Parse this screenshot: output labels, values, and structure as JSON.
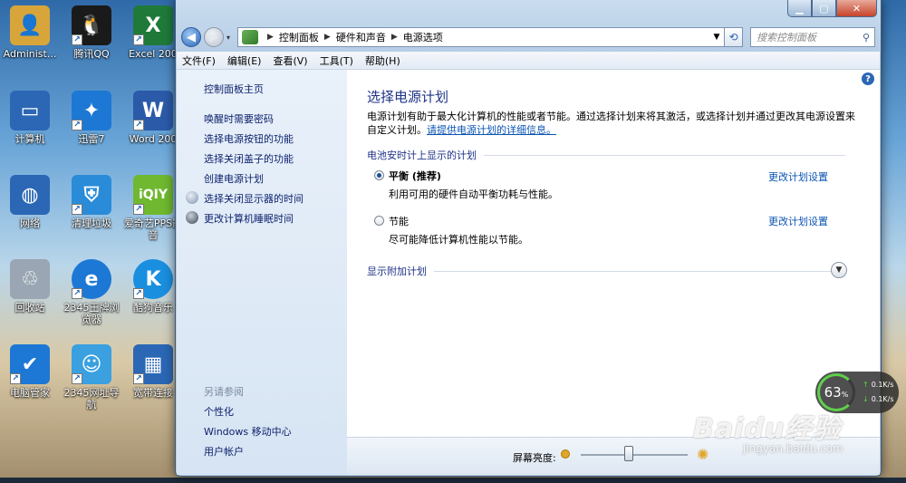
{
  "desktop": {
    "icons": [
      {
        "label": "Administ...",
        "glyph": "user-folder-icon",
        "color": "#d8a53a"
      },
      {
        "label": "腾讯QQ",
        "glyph": "qq-penguin-icon",
        "color": "#1a1a1a"
      },
      {
        "label": "Excel 200",
        "glyph": "excel-icon",
        "color": "#1f7a3a"
      },
      {
        "label": "计算机",
        "glyph": "computer-icon",
        "color": "#2b67b5"
      },
      {
        "label": "迅雷7",
        "glyph": "thunder-icon",
        "color": "#1c78d4"
      },
      {
        "label": "Word 200",
        "glyph": "word-icon",
        "color": "#2b5aa8"
      },
      {
        "label": "网络",
        "glyph": "network-icon",
        "color": "#2b67b5"
      },
      {
        "label": "清理垃圾",
        "glyph": "shield-clean-icon",
        "color": "#2a8bd8"
      },
      {
        "label": "爱奇艺PPS影音",
        "glyph": "iqiyi-icon",
        "color": "#6fb82f"
      },
      {
        "label": "回收站",
        "glyph": "recycle-bin-icon",
        "color": "#9aa6b4"
      },
      {
        "label": "2345王牌浏览器",
        "glyph": "browser-e-icon",
        "color": "#1c78d4"
      },
      {
        "label": "酷狗音乐",
        "glyph": "kugou-icon",
        "color": "#1a8fe0"
      },
      {
        "label": "电脑管家",
        "glyph": "pc-manager-icon",
        "color": "#1c78d4"
      },
      {
        "label": "2345网址导航",
        "glyph": "nav-mascot-icon",
        "color": "#3aa0e0"
      },
      {
        "label": "宽带连接",
        "glyph": "broadband-icon",
        "color": "#2b67b5"
      }
    ]
  },
  "window": {
    "address": {
      "crumbs": [
        "控制面板",
        "硬件和声音",
        "电源选项"
      ],
      "search_placeholder": "搜索控制面板"
    },
    "menu": [
      "文件(F)",
      "编辑(E)",
      "查看(V)",
      "工具(T)",
      "帮助(H)"
    ],
    "sidebar": {
      "home": "控制面板主页",
      "links": [
        "唤醒时需要密码",
        "选择电源按钮的功能",
        "选择关闭盖子的功能",
        "创建电源计划",
        "选择关闭显示器的时间",
        "更改计算机睡眠时间"
      ],
      "see_also_heading": "另请参阅",
      "see_also": [
        "个性化",
        "Windows 移动中心",
        "用户帐户"
      ]
    },
    "main": {
      "title": "选择电源计划",
      "desc": "电源计划有助于最大化计算机的性能或者节能。通过选择计划来将其激活，或选择计划并通过更改其电源设置来自定义计划。",
      "desc_link": "请提供电源计划的详细信息。",
      "section_label": "电池安时计上显示的计划",
      "plans": [
        {
          "name": "平衡 (推荐)",
          "desc": "利用可用的硬件自动平衡功耗与性能。",
          "link": "更改计划设置",
          "selected": true
        },
        {
          "name": "节能",
          "desc": "尽可能降低计算机性能以节能。",
          "link": "更改计划设置",
          "selected": false
        }
      ],
      "more_plans": "显示附加计划",
      "brightness_label": "屏幕亮度:",
      "brightness_level": 0.45
    }
  },
  "net_widget": {
    "percent": "63",
    "unit": "%",
    "up": "0.1K/s",
    "down": "0.1K/s"
  },
  "watermark": {
    "text": "Baidu经验",
    "url": "jingyan.baidu.com"
  }
}
